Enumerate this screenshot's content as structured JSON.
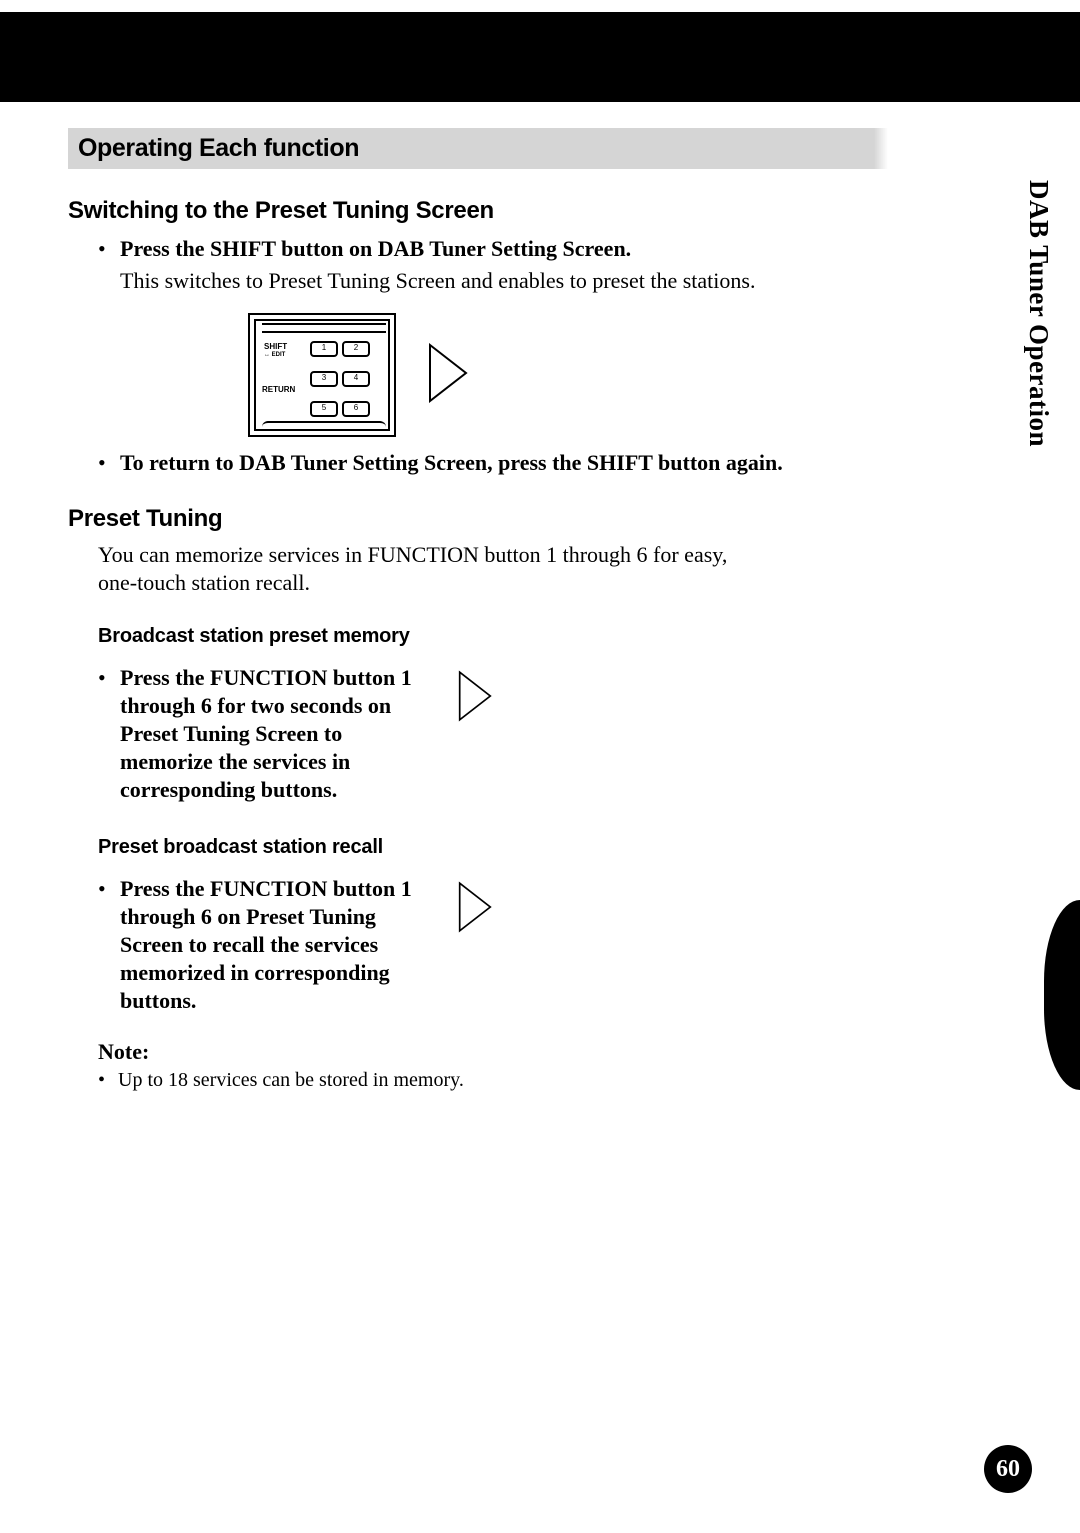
{
  "header": {
    "section_title": "Operating Each function"
  },
  "side_tab": {
    "label": "DAB Tuner Operation"
  },
  "page_number": "60",
  "s1": {
    "title": "Switching to the Preset Tuning Screen",
    "b1": "Press the SHIFT button on DAB Tuner Setting Screen.",
    "b1_desc": "This switches to Preset Tuning Screen and enables to preset the stations.",
    "b2": "To return to DAB Tuner Setting Screen, press the SHIFT button again."
  },
  "s2": {
    "title": "Preset Tuning",
    "intro": "You can memorize services in FUNCTION button 1 through 6 for easy, one-touch station recall.",
    "h1": "Broadcast station preset memory",
    "b1": "Press the FUNCTION button 1 through 6 for two seconds on Preset Tuning Screen to memorize the services in corresponding buttons.",
    "h2": "Preset broadcast station recall",
    "b2": "Press the FUNCTION button 1 through 6 on Preset Tuning Screen to recall the services memorized in corresponding buttons.",
    "note_label": "Note:",
    "note_1": "Up to 18 services can be stored in memory."
  },
  "remote": {
    "shift": "SHIFT",
    "shift_sub": "↔ EDIT",
    "return": "RETURN",
    "btn1": "1",
    "btn2": "2",
    "btn3": "3",
    "btn4": "4",
    "btn5": "5",
    "btn6": "6"
  }
}
